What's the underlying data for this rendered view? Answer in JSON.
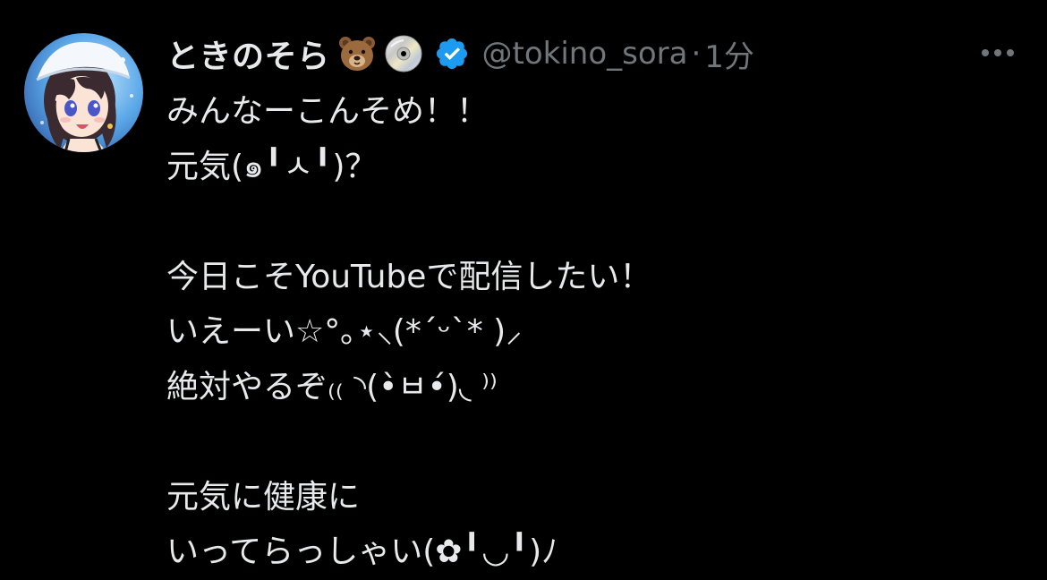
{
  "tweet": {
    "display_name": "ときのそら",
    "name_emojis": [
      "bear-face-emoji",
      "dvd-disc-emoji"
    ],
    "verified_color": "#1d9bf0",
    "handle": "@tokino_sora",
    "separator": "·",
    "time": "1分",
    "more_icon": "more-dots-icon",
    "lines": [
      "みんなーこんそめ！！",
      "元気(๑╹ㅅ╹)？",
      "",
      "今日こそYouTubeで配信したい！",
      "いえーい☆°｡⋆⸜(*ˊᵕˋ* )⸝",
      "絶対やるぞ₍₍ ◝(•̀ㅂ•́)◟ ⁾⁾",
      "",
      "元気に健康に",
      "いってらっしゃい(✿╹◡╹)ﾉ"
    ]
  },
  "colors": {
    "background": "#000000",
    "text": "#e7e9ea",
    "secondary": "#71767b",
    "accent": "#1d9bf0"
  }
}
